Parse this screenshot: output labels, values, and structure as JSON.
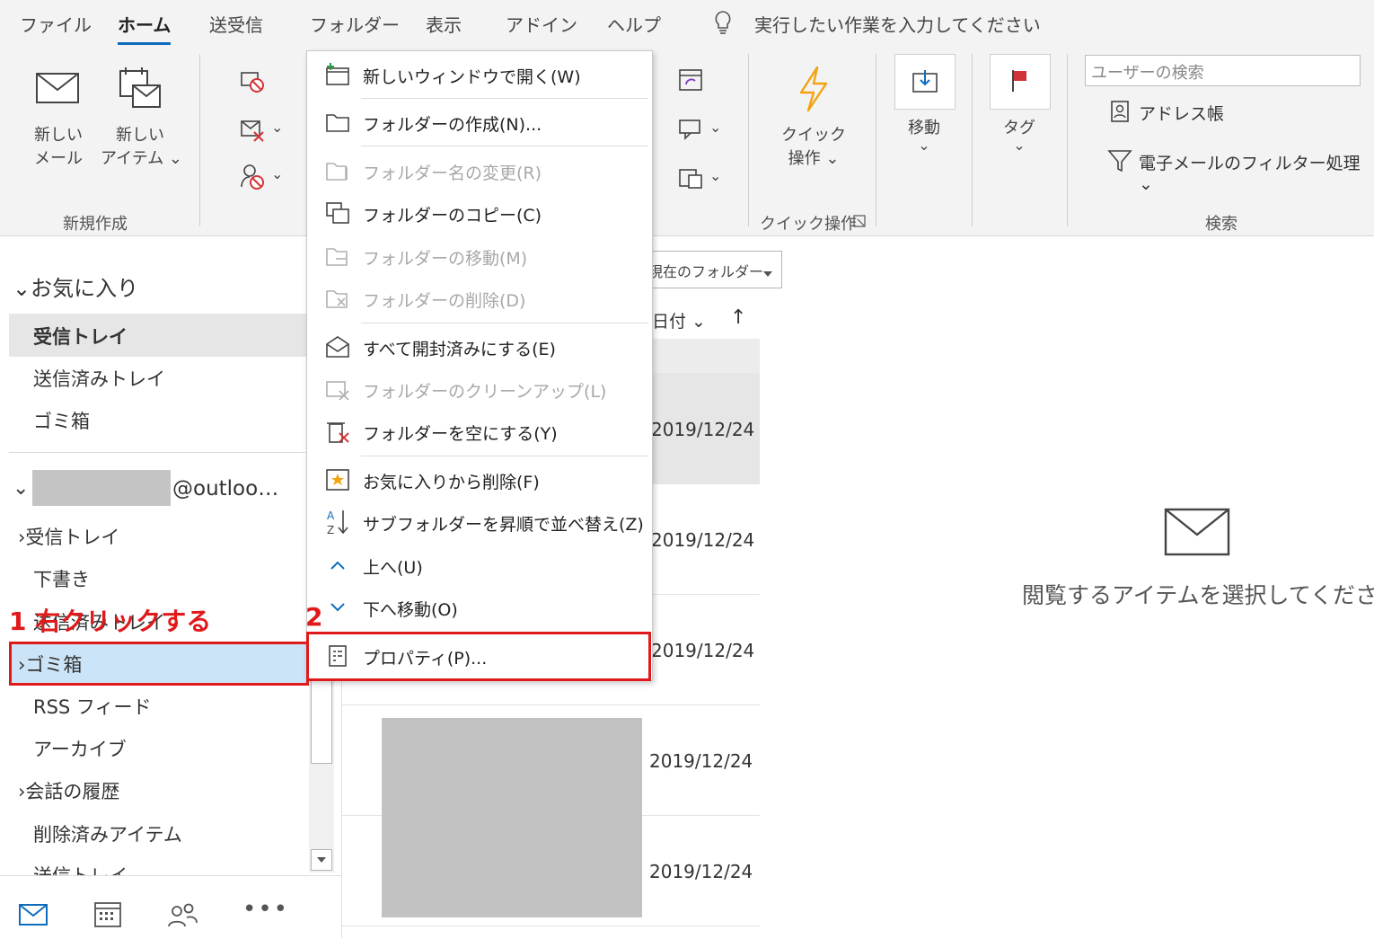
{
  "menu": {
    "tabs": [
      "ファイル",
      "ホーム",
      "送受信",
      "フォルダー",
      "表示",
      "アドイン",
      "ヘルプ"
    ],
    "tell_me": "実行したい作業を入力してください"
  },
  "ribbon": {
    "new_mail_l1": "新しい",
    "new_mail_l2": "メール",
    "new_item_l1": "新しい",
    "new_item_l2": "アイテム",
    "group_new": "新規作成",
    "quick_steps_l1": "クイック",
    "quick_steps_l2": "操作",
    "group_quick": "クイック操作",
    "move": "移動",
    "tags": "タグ",
    "search_people_placeholder": "ユーザーの検索",
    "address_book": "アドレス帳",
    "filter_email": "電子メールのフィルター処理",
    "group_search": "検索"
  },
  "folders": {
    "favorites_header": "お気に入り",
    "favorites": [
      "受信トレイ",
      "送信済みトレイ",
      "ゴミ箱"
    ],
    "account_suffix": "@outloo…",
    "account_items": [
      {
        "label": "受信トレイ",
        "chevron": true
      },
      {
        "label": "下書き",
        "chevron": false
      },
      {
        "label": "送信済みトレイ",
        "chevron": false
      },
      {
        "label": "ゴミ箱",
        "chevron": true
      },
      {
        "label": "RSS フィード",
        "chevron": false
      },
      {
        "label": "アーカイブ",
        "chevron": false
      },
      {
        "label": "会話の履歴",
        "chevron": true
      },
      {
        "label": "削除済みアイテム",
        "chevron": false
      },
      {
        "label": "送信トレイ",
        "chevron": false
      }
    ]
  },
  "message_list": {
    "scope": "現在のフォルダー",
    "sort": "日付",
    "dates": [
      "2019/12/24",
      "2019/12/24",
      "2019/12/24",
      "2019/12/24",
      "2019/12/24"
    ]
  },
  "context_menu": {
    "items": [
      {
        "label": "新しいウィンドウで開く(W)",
        "disabled": false
      },
      {
        "label": "フォルダーの作成(N)...",
        "disabled": false
      },
      {
        "label": "フォルダー名の変更(R)",
        "disabled": true
      },
      {
        "label": "フォルダーのコピー(C)",
        "disabled": false
      },
      {
        "label": "フォルダーの移動(M)",
        "disabled": true
      },
      {
        "label": "フォルダーの削除(D)",
        "disabled": true
      },
      {
        "label": "すべて開封済みにする(E)",
        "disabled": false
      },
      {
        "label": "フォルダーのクリーンアップ(L)",
        "disabled": true
      },
      {
        "label": "フォルダーを空にする(Y)",
        "disabled": false
      },
      {
        "label": "お気に入りから削除(F)",
        "disabled": false
      },
      {
        "label": "サブフォルダーを昇順で並べ替え(Z)",
        "disabled": false
      },
      {
        "label": "上へ(U)",
        "disabled": false
      },
      {
        "label": "下へ移動(O)",
        "disabled": false
      },
      {
        "label": "プロパティ(P)...",
        "disabled": false
      }
    ]
  },
  "reading_pane": {
    "empty_text": "閲覧するアイテムを選択してください"
  },
  "annotations": {
    "step1": "1 右クリックする",
    "step2": "2"
  },
  "colors": {
    "accent": "#0f6cbd",
    "annotation_red": "#e0191b",
    "selected_folder_bg": "#cce4f7",
    "favorite_selected_bg": "#e6e6e6"
  }
}
